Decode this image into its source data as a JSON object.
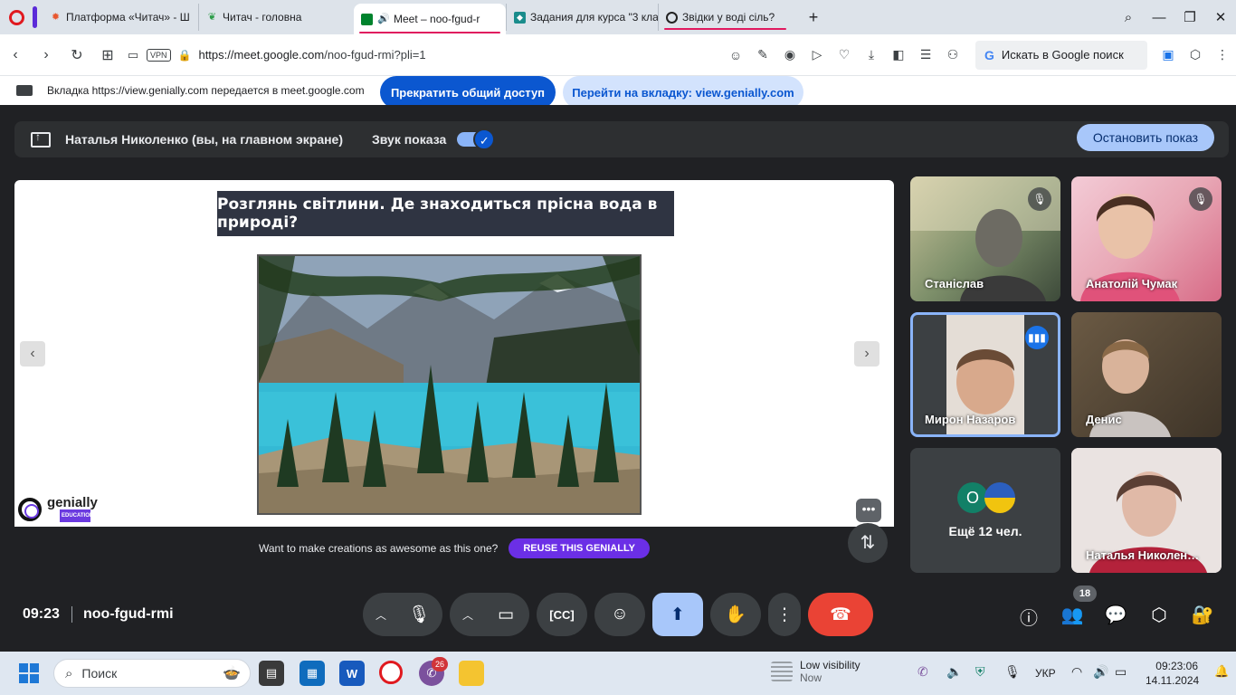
{
  "browser": {
    "tabs": [
      {
        "title": "Платформа «Читач» - Ш",
        "icon": "bug-favicon",
        "color": "#e8572f"
      },
      {
        "title": "Читач - головна",
        "icon": "leaf-favicon",
        "color": "#2e9d4a"
      },
      {
        "title": "Meet – noo-fgud-r",
        "icon": "meet-favicon",
        "color": "#00832d",
        "active": true
      },
      {
        "title": "Задания для курса \"3 кла",
        "icon": "classroom-favicon",
        "color": "#1a8c8c"
      },
      {
        "title": "Звідки у воді сіль?",
        "icon": "genially-favicon",
        "color": "#222222"
      }
    ],
    "url_host": "https://meet.google.com",
    "url_path": "/noo-fgud-rmi?pli=1",
    "vpn_label": "VPN",
    "search_label": "Искать в Google поиск"
  },
  "sharing_bar": {
    "message": "Вкладка https://view.genially.com передается в meet.google.com",
    "stop_label": "Прекратить общий доступ",
    "goto_label": "Перейти на вкладку: view.genially.com"
  },
  "presenting": {
    "presenter": "Наталья Николенко (вы, на главном экране)",
    "sound_label": "Звук показа",
    "stop_label": "Остановить показ"
  },
  "slide": {
    "title": "Розглянь світлини. Де знаходиться прісна вода в природі?",
    "logo_text": "genially",
    "logo_sub": "EDUCATION",
    "footer_text": "Want to make creations as awesome as this one?",
    "reuse_label": "REUSE THIS GENIALLY"
  },
  "participants": [
    {
      "name": "Станіслав",
      "muted": true
    },
    {
      "name": "Анатолій Чумак",
      "muted": true
    },
    {
      "name": "Мирон Назаров",
      "speaking": true
    },
    {
      "name": "Денис"
    },
    {
      "name": "Наталья Николен…"
    }
  ],
  "more_participants": {
    "label": "Ещё 12 чел.",
    "avatar_letter": "О",
    "avatar_color": "#128067"
  },
  "controls": {
    "time": "09:23",
    "meeting_code": "noo-fgud-rmi",
    "people_count": "18"
  },
  "taskbar": {
    "search_placeholder": "Поиск",
    "viber_badge": "26",
    "weather_title": "Low visibility",
    "weather_sub": "Now",
    "language": "УКР",
    "time": "09:23:06",
    "date": "14.11.2024"
  }
}
